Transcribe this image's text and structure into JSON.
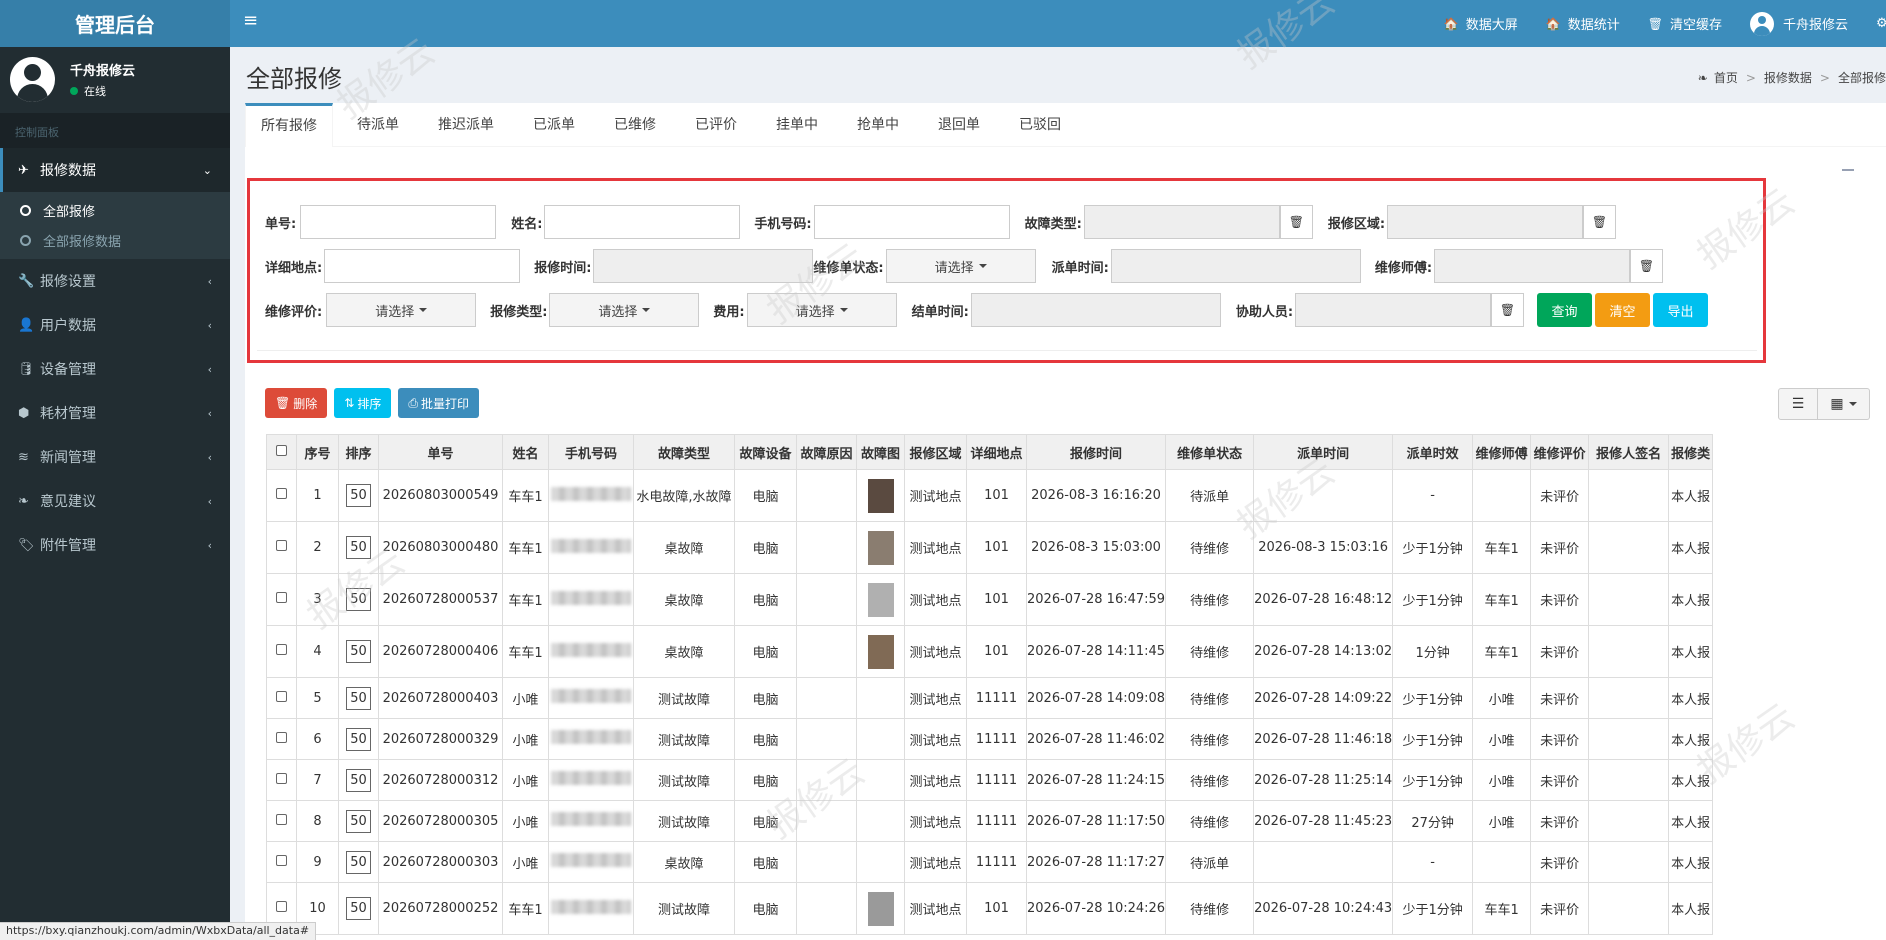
{
  "brand": "管理后台",
  "header": {
    "items": [
      {
        "label": "数据大屏"
      },
      {
        "label": "数据统计"
      },
      {
        "label": "清空缓存"
      },
      {
        "label": "千舟报修云"
      }
    ]
  },
  "user": {
    "name": "千舟报修云",
    "status": "在线"
  },
  "sidebar": {
    "header": "控制面板",
    "items": [
      {
        "label": "报修数据"
      },
      {
        "label": "报修设置"
      },
      {
        "label": "用户数据"
      },
      {
        "label": "设备管理"
      },
      {
        "label": "耗材管理"
      },
      {
        "label": "新闻管理"
      },
      {
        "label": "意见建议"
      },
      {
        "label": "附件管理"
      }
    ],
    "submenu": [
      {
        "label": "全部报修"
      },
      {
        "label": "全部报修数据"
      }
    ]
  },
  "page": {
    "title": "全部报修",
    "breadcrumb": [
      "首页",
      "报修数据",
      "全部报修"
    ]
  },
  "tabs": [
    "所有报修",
    "待派单",
    "推迟派单",
    "已派单",
    "已维修",
    "已评价",
    "挂单中",
    "抢单中",
    "退回单",
    "已驳回"
  ],
  "filters": {
    "order_no": "单号:",
    "name": "姓名:",
    "phone": "手机号码:",
    "fault_type": "故障类型:",
    "area": "报修区域:",
    "address": "详细地点:",
    "report_time": "报修时间:",
    "status": "维修单状态:",
    "dispatch_time": "派单时间:",
    "worker": "维修师傅:",
    "rating": "维修评价:",
    "report_type": "报修类型:",
    "fee": "费用:",
    "close_time": "结单时间:",
    "helper": "协助人员:",
    "select_placeholder": "请选择",
    "query": "查询",
    "clear": "清空",
    "export": "导出"
  },
  "toolbar": {
    "delete": "删除",
    "sort": "排序",
    "print": "批量打印"
  },
  "table": {
    "columns": [
      "序号",
      "排序",
      "单号",
      "姓名",
      "手机号码",
      "故障类型",
      "故障设备",
      "故障原因",
      "故障图",
      "报修区域",
      "详细地点",
      "报修时间",
      "维修单状态",
      "派单时间",
      "派单时效",
      "维修师傅",
      "维修评价",
      "报修人签名",
      "报修类"
    ],
    "rows": [
      {
        "no": "1",
        "sort": "50",
        "order": "20260803000549",
        "name": "车车1",
        "fault": "水电故障,水故障",
        "device": "电脑",
        "area": "测试地点",
        "addr": "101",
        "time": "2026-08-3 16:16:20",
        "status": "待派单",
        "dispatch": "",
        "eff": "-",
        "worker": "",
        "rating": "未评价",
        "type": "本人报"
      },
      {
        "no": "2",
        "sort": "50",
        "order": "20260803000480",
        "name": "车车1",
        "fault": "桌故障",
        "device": "电脑",
        "area": "测试地点",
        "addr": "101",
        "time": "2026-08-3 15:03:00",
        "status": "待维修",
        "dispatch": "2026-08-3 15:03:16",
        "eff": "少于1分钟",
        "worker": "车车1",
        "rating": "未评价",
        "type": "本人报"
      },
      {
        "no": "3",
        "sort": "50",
        "order": "20260728000537",
        "name": "车车1",
        "fault": "桌故障",
        "device": "电脑",
        "area": "测试地点",
        "addr": "101",
        "time": "2026-07-28 16:47:59",
        "status": "待维修",
        "dispatch": "2026-07-28 16:48:12",
        "eff": "少于1分钟",
        "worker": "车车1",
        "rating": "未评价",
        "type": "本人报"
      },
      {
        "no": "4",
        "sort": "50",
        "order": "20260728000406",
        "name": "车车1",
        "fault": "桌故障",
        "device": "电脑",
        "area": "测试地点",
        "addr": "101",
        "time": "2026-07-28 14:11:45",
        "status": "待维修",
        "dispatch": "2026-07-28 14:13:02",
        "eff": "1分钟",
        "worker": "车车1",
        "rating": "未评价",
        "type": "本人报"
      },
      {
        "no": "5",
        "sort": "50",
        "order": "20260728000403",
        "name": "小唯",
        "fault": "测试故障",
        "device": "电脑",
        "area": "测试地点",
        "addr": "11111",
        "time": "2026-07-28 14:09:08",
        "status": "待维修",
        "dispatch": "2026-07-28 14:09:22",
        "eff": "少于1分钟",
        "worker": "小唯",
        "rating": "未评价",
        "type": "本人报"
      },
      {
        "no": "6",
        "sort": "50",
        "order": "20260728000329",
        "name": "小唯",
        "fault": "测试故障",
        "device": "电脑",
        "area": "测试地点",
        "addr": "11111",
        "time": "2026-07-28 11:46:02",
        "status": "待维修",
        "dispatch": "2026-07-28 11:46:18",
        "eff": "少于1分钟",
        "worker": "小唯",
        "rating": "未评价",
        "type": "本人报"
      },
      {
        "no": "7",
        "sort": "50",
        "order": "20260728000312",
        "name": "小唯",
        "fault": "测试故障",
        "device": "电脑",
        "area": "测试地点",
        "addr": "11111",
        "time": "2026-07-28 11:24:15",
        "status": "待维修",
        "dispatch": "2026-07-28 11:25:14",
        "eff": "少于1分钟",
        "worker": "小唯",
        "rating": "未评价",
        "type": "本人报"
      },
      {
        "no": "8",
        "sort": "50",
        "order": "20260728000305",
        "name": "小唯",
        "fault": "测试故障",
        "device": "电脑",
        "area": "测试地点",
        "addr": "11111",
        "time": "2026-07-28 11:17:50",
        "status": "待维修",
        "dispatch": "2026-07-28 11:45:23",
        "eff": "27分钟",
        "worker": "小唯",
        "rating": "未评价",
        "type": "本人报"
      },
      {
        "no": "9",
        "sort": "50",
        "order": "20260728000303",
        "name": "小唯",
        "fault": "桌故障",
        "device": "电脑",
        "area": "测试地点",
        "addr": "11111",
        "time": "2026-07-28 11:17:27",
        "status": "待派单",
        "dispatch": "",
        "eff": "-",
        "worker": "",
        "rating": "未评价",
        "type": "本人报"
      },
      {
        "no": "10",
        "sort": "50",
        "order": "20260728000252",
        "name": "车车1",
        "fault": "测试故障",
        "device": "电脑",
        "area": "测试地点",
        "addr": "101",
        "time": "2026-07-28 10:24:26",
        "status": "待维修",
        "dispatch": "2026-07-28 10:24:43",
        "eff": "少于1分钟",
        "worker": "车车1",
        "rating": "未评价",
        "type": "本人报"
      }
    ]
  },
  "statusbar": "https://bxy.qianzhoukj.com/admin/WxbxData/all_data#",
  "watermark": "报修云"
}
